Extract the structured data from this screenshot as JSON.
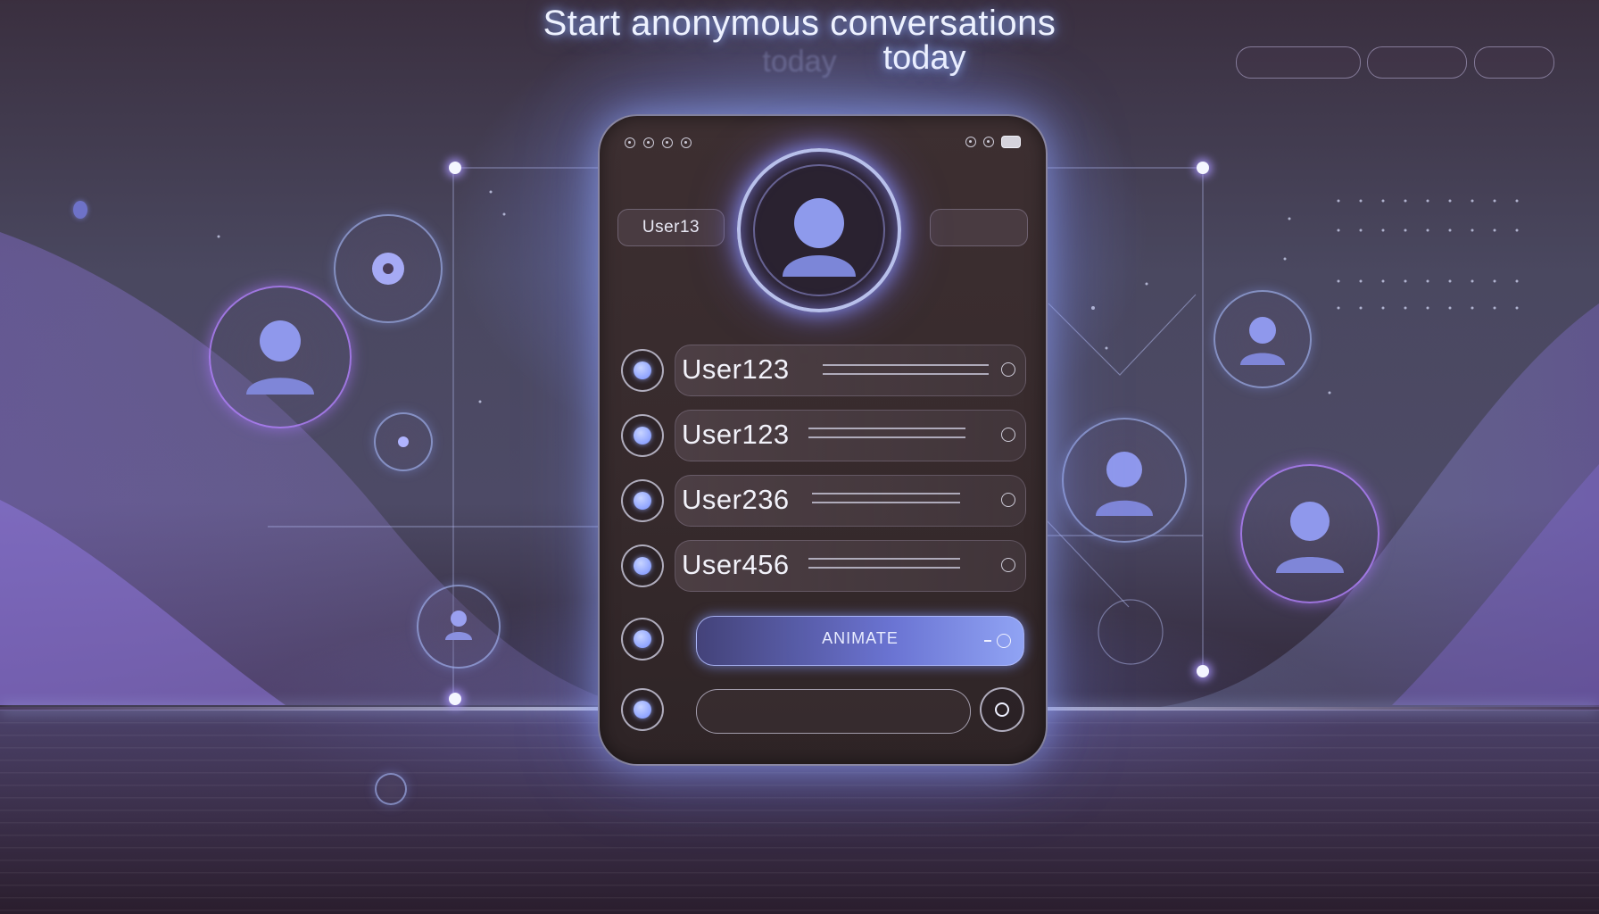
{
  "header": {
    "title_line1": "Start anonymous conversations",
    "title_line2": "today"
  },
  "top_pills": [
    "",
    "",
    ""
  ],
  "phone": {
    "header_user_label": "User13",
    "rows": [
      {
        "label": "User123"
      },
      {
        "label": "User123"
      },
      {
        "label": "User236"
      },
      {
        "label": "User456"
      }
    ],
    "animate_button_label": "ANIMATE"
  },
  "colors": {
    "accent": "#8fa4ff",
    "glow": "#aab8ff",
    "phone_body": "#362a2c",
    "background": "#4a4860"
  }
}
